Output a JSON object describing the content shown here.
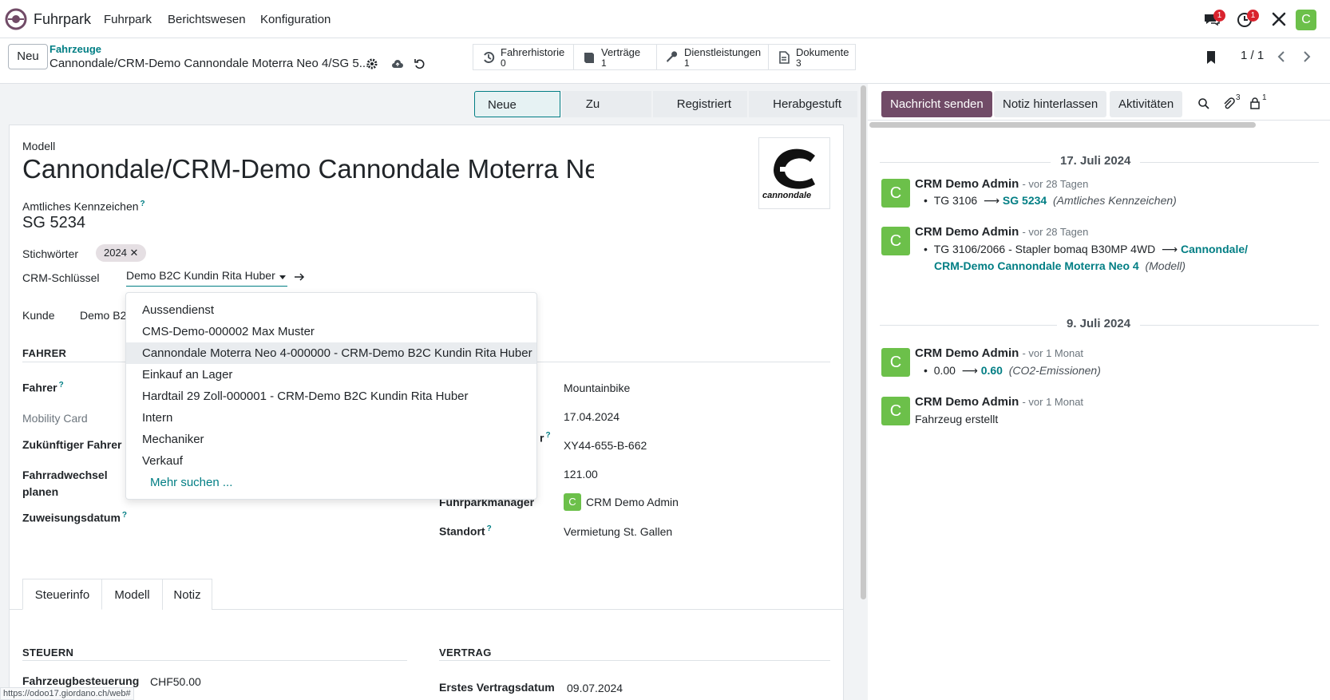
{
  "navbar": {
    "app_name": "Fuhrpark",
    "menu": [
      "Fuhrpark",
      "Berichtswesen",
      "Konfiguration"
    ],
    "messages_badge": "1",
    "activities_badge": "1",
    "user_initial": "C",
    "icons": [
      "odoo-logo-icon",
      "chat-icon",
      "clock-icon",
      "tools-icon"
    ]
  },
  "control_panel": {
    "new_label": "Neu",
    "breadcrumb_parent": "Fahrzeuge",
    "breadcrumb_current": "Cannondale/CRM-Demo Cannondale Moterra Neo 4/SG 5...",
    "smart_buttons": [
      {
        "label": "Fahrerhistorie",
        "count": "0",
        "icon": "history-icon"
      },
      {
        "label": "Verträge",
        "count": "1",
        "icon": "book-icon"
      },
      {
        "label": "Dienstleistungen",
        "count": "1",
        "icon": "wrench-icon"
      },
      {
        "label": "Dokumente",
        "count": "3",
        "icon": "file-icon"
      }
    ],
    "pager": "1 / 1"
  },
  "statusbar": [
    "Neue Anfrage",
    "Zu bestellen",
    "Registriert",
    "Herabgestuft"
  ],
  "form": {
    "model_label": "Modell",
    "model_value": "Cannondale/CRM-Demo Cannondale Moterra Neo",
    "logo_text": "cannondale",
    "plate_label": "Amtliches Kennzeichen",
    "plate_value": "SG 5234",
    "tags_label": "Stichwörter",
    "tag": "2024",
    "crm_key_label": "CRM-Schlüssel",
    "crm_key_value": "Demo B2C Kundin Rita Huber",
    "customer_label": "Kunde",
    "customer_value": "Demo B2",
    "driver_section": "FAHRER",
    "driver_label": "Fahrer",
    "mobility_card_label": "Mobility Card",
    "future_driver_label": "Zukünftiger Fahrer",
    "bike_change_label_1": "Fahrradwechsel",
    "bike_change_label_2": "planen",
    "assign_date_label": "Zuweisungsdatum",
    "right_values": [
      "Mountainbike",
      "17.04.2024",
      "XY44-655-B-662",
      "121.00"
    ],
    "right_label_tail": "r",
    "fleet_manager_label": "Fuhrparkmanager",
    "fleet_manager_value": "CRM Demo Admin",
    "location_label": "Standort",
    "location_value": "Vermietung St. Gallen",
    "tabs": [
      "Steuerinfo",
      "Modell",
      "Notiz"
    ],
    "tax_section": "STEUERN",
    "tax_label": "Fahrzeugbesteuerung",
    "tax_value": "CHF50.00",
    "contract_section": "VERTRAG",
    "contract_label": "Erstes Vertragsdatum",
    "contract_value": "09.07.2024"
  },
  "dropdown": {
    "items": [
      "Aussendienst",
      "CMS-Demo-000002 Max Muster",
      "Cannondale Moterra Neo 4-000000 - CRM-Demo B2C Kundin Rita Huber",
      "Einkauf an Lager",
      "Hardtail 29 Zoll-000001 - CRM-Demo B2C Kundin Rita Huber",
      "Intern",
      "Mechaniker",
      "Verkauf"
    ],
    "more": "Mehr suchen ..."
  },
  "chatter": {
    "send_message": "Nachricht senden",
    "log_note": "Notiz hinterlassen",
    "activities": "Aktivitäten",
    "attachments_count": "3",
    "followers_count": "1",
    "dates": [
      "17. Juli 2024",
      "9. Juli 2024"
    ],
    "messages": [
      {
        "author": "CRM Demo Admin",
        "when": "- vor 28 Tagen",
        "old": "TG 3106",
        "new": "SG 5234",
        "field": "(Amtliches Kennzeichen)"
      },
      {
        "author": "CRM Demo Admin",
        "when": "- vor 28 Tagen",
        "old": "TG 3106/2066 - Stapler bomaq B30MP 4WD",
        "new_1": "Cannondale/",
        "new_2": "CRM-Demo Cannondale Moterra Neo 4",
        "field": "(Modell)"
      },
      {
        "author": "CRM Demo Admin",
        "when": "- vor 1 Monat",
        "old": "0.00",
        "new": "0.60",
        "field": "(CO2-Emissionen)"
      },
      {
        "author": "CRM Demo Admin",
        "when": "- vor 1 Monat",
        "body": "Fahrzeug erstellt"
      }
    ]
  },
  "status_url": "https://odoo17.giordano.ch/web#",
  "colors": {
    "brand": "#714b67",
    "accent": "#017e84",
    "avatar": "#6cc04a"
  }
}
